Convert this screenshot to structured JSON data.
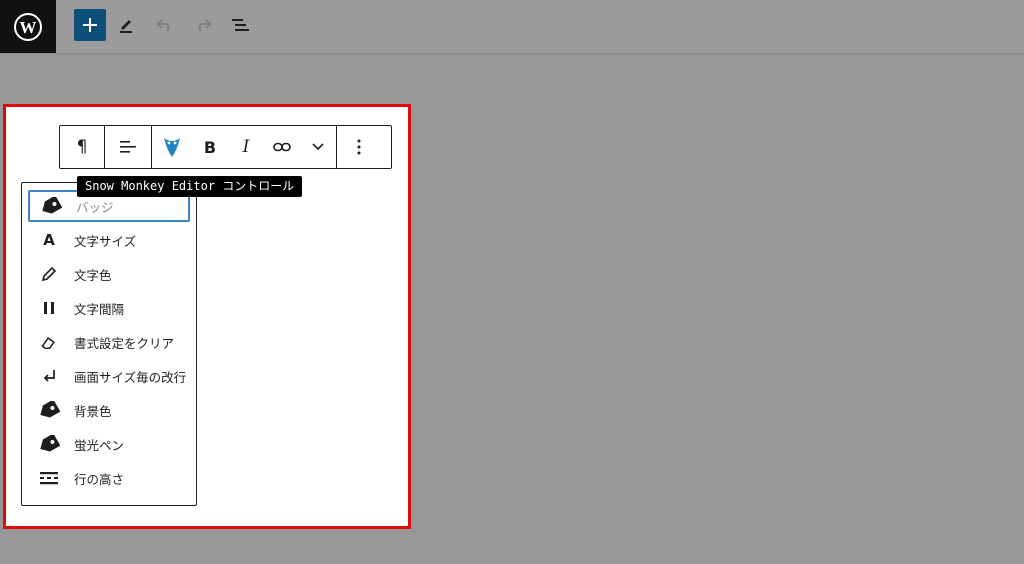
{
  "header": {
    "logo": "wordpress-logo",
    "buttons": [
      {
        "name": "add-block",
        "icon": "plus-icon"
      },
      {
        "name": "tools",
        "icon": "pen-icon"
      },
      {
        "name": "undo",
        "icon": "undo-icon"
      },
      {
        "name": "redo",
        "icon": "redo-icon"
      },
      {
        "name": "list-view",
        "icon": "list-icon"
      }
    ]
  },
  "block_toolbar": {
    "buttons": [
      "paragraph-icon",
      "align-icon",
      "snow-monkey-icon",
      "bold-icon",
      "italic-icon",
      "link-icon",
      "chevron-down-icon",
      "more-options-icon"
    ]
  },
  "tooltip": {
    "text": "Snow Monkey Editor コントロール"
  },
  "menu": {
    "items": [
      {
        "label": "バッジ",
        "icon": "tag-icon"
      },
      {
        "label": "文字サイズ",
        "icon": "letter-a-icon"
      },
      {
        "label": "文字色",
        "icon": "pencil-icon"
      },
      {
        "label": "文字間隔",
        "icon": "spacing-icon"
      },
      {
        "label": "書式設定をクリア",
        "icon": "eraser-icon"
      },
      {
        "label": "画面サイズ毎の改行",
        "icon": "return-icon"
      },
      {
        "label": "背景色",
        "icon": "tag-icon"
      },
      {
        "label": "蛍光ペン",
        "icon": "tag-icon"
      },
      {
        "label": "行の高さ",
        "icon": "line-height-icon"
      }
    ]
  },
  "colors": {
    "accent": "#0d4f78",
    "highlight_border": "#e10a0a",
    "focus": "#3a86c8"
  }
}
